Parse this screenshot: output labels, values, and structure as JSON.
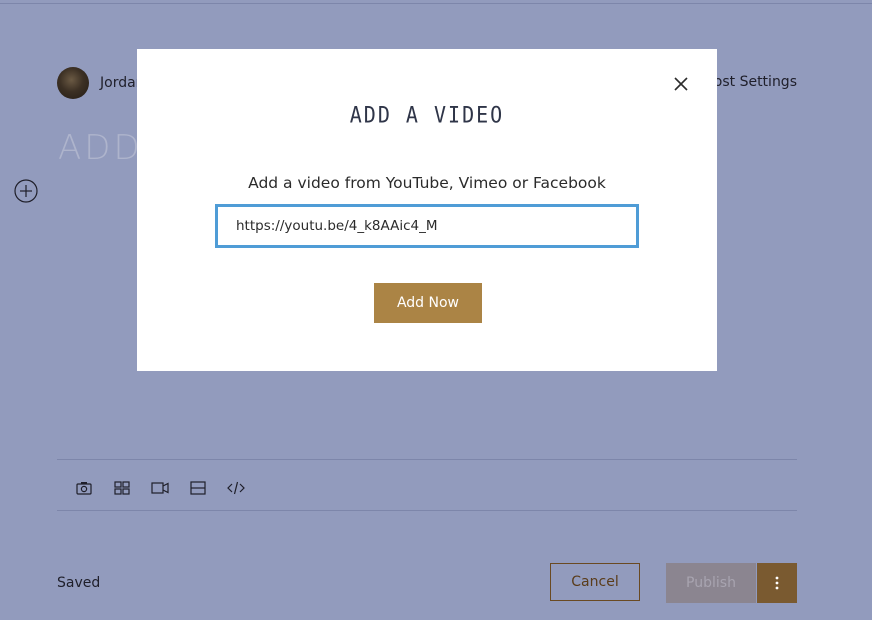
{
  "editor": {
    "author_name": "Jordan",
    "post_settings_label": "Post Settings",
    "title_placeholder": "ADD A C",
    "saved_label": "Saved",
    "cancel_label": "Cancel",
    "publish_label": "Publish"
  },
  "toolbar": {
    "items": [
      "camera-icon",
      "gallery-icon",
      "video-icon",
      "divider-icon",
      "code-icon"
    ]
  },
  "modal": {
    "title": "ADD A VIDEO",
    "subtitle": "Add a video from YouTube, Vimeo or Facebook",
    "input_value": "https://youtu.be/4_k8AAic4_M",
    "add_now_label": "Add Now"
  },
  "colors": {
    "overlay_bg": "#929bbd",
    "accent": "#ab8445",
    "input_border": "#4f9cd6"
  }
}
